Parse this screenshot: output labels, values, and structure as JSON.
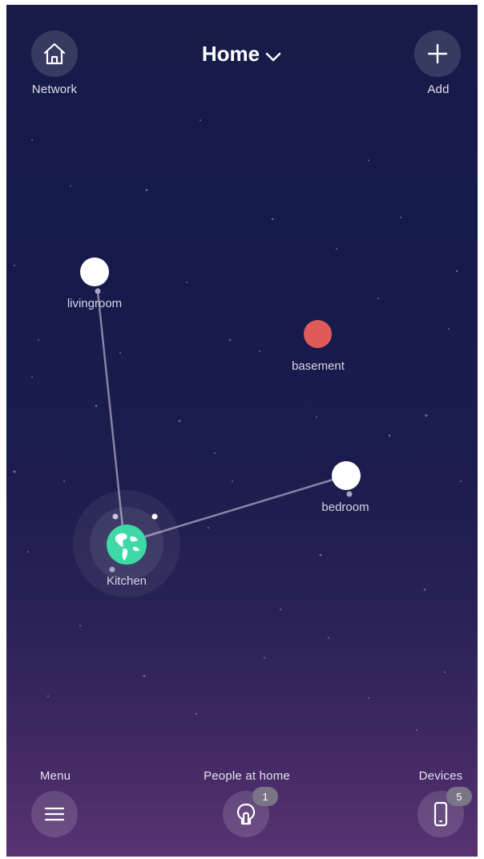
{
  "header": {
    "title": "Home",
    "network_label": "Network",
    "add_label": "Add"
  },
  "rooms": {
    "livingroom": "livingroom",
    "basement": "basement",
    "bedroom": "bedroom",
    "kitchen": "Kitchen"
  },
  "footer": {
    "menu_label": "Menu",
    "people_label": "People at home",
    "people_count": "1",
    "devices_label": "Devices",
    "devices_count": "5"
  },
  "colors": {
    "accent_green": "#3dd9a6",
    "basement_red": "#e05a5a",
    "node_white": "#ffffff"
  },
  "icons": {
    "network": "home-icon",
    "add": "plus-icon",
    "title": "chevron-down-icon",
    "kitchen": "globe-icon",
    "menu": "hamburger-icon",
    "people": "person-icon",
    "devices": "phone-icon"
  }
}
